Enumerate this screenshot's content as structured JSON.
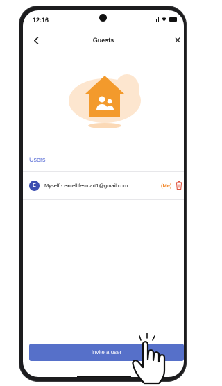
{
  "status_bar": {
    "time": "12:16"
  },
  "header": {
    "title": "Guests",
    "back_icon": "chevron-left-icon",
    "close_label": "✕"
  },
  "illustration": {
    "icon": "house-with-people-icon",
    "accent_color": "#f39a2c",
    "blob_color": "#fde6cf"
  },
  "users_section": {
    "label": "Users",
    "items": [
      {
        "avatar_letter": "E",
        "name": "Myself - excellifesmart1@gmail.com",
        "badge": "(Me)",
        "action_icon": "trash-icon"
      }
    ]
  },
  "footer": {
    "invite_label": "Invite a user"
  },
  "colors": {
    "primary": "#5670c9",
    "avatar": "#3d4fb0",
    "me_badge": "#f28a2e",
    "delete": "#e0533d"
  }
}
